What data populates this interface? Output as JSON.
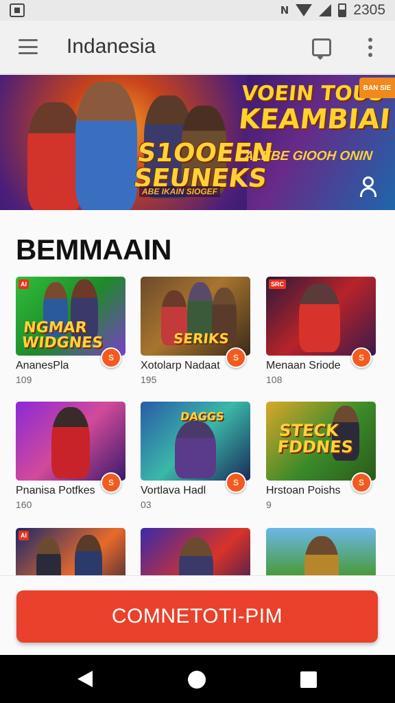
{
  "status_bar": {
    "signal_text": "N",
    "time": "2305"
  },
  "app_bar": {
    "title": "Indanesia"
  },
  "banner": {
    "logo_line1": "S1OOEEN",
    "logo_line2": "SEUNEKS",
    "logo_sub": "ABE IKAIN SIOGEF",
    "headline_line1": "VOEIN TOUS",
    "headline_line2": "KEAMBIAI",
    "tagline": "ALKBE GIOOH ONIN",
    "badge": "BAN SIE"
  },
  "section": {
    "title": "BEMMAAIN"
  },
  "games": [
    {
      "name": "AnanesPla",
      "count": "109",
      "thumb_text": "NGMAR WIDGNES",
      "tag": "AI"
    },
    {
      "name": "Xotolarp Nadaat",
      "count": "195",
      "thumb_text": "SERIKS",
      "tag": ""
    },
    {
      "name": "Menaan Sriode",
      "count": "108",
      "thumb_text": "",
      "tag": "SRC"
    },
    {
      "name": "Pnanisa Potfkes",
      "count": "160",
      "thumb_text": "",
      "tag": ""
    },
    {
      "name": "Vortlava Hadl",
      "count": "03",
      "thumb_text": "DAGGS",
      "tag": ""
    },
    {
      "name": "Hrstoan Poishs",
      "count": "9",
      "thumb_text": "STECK FDDNES",
      "tag": ""
    },
    {
      "name": "",
      "count": "",
      "thumb_text": "",
      "tag": "AI"
    },
    {
      "name": "",
      "count": "",
      "thumb_text": "",
      "tag": ""
    },
    {
      "name": "",
      "count": "",
      "thumb_text": "",
      "tag": ""
    }
  ],
  "play_badge_label": "S",
  "cta": {
    "label": "COMNETOTI-PIM"
  },
  "colors": {
    "accent": "#e9412c",
    "badge": "#f15a22",
    "logo_gold": "#ffd23a"
  },
  "icons": [
    "menu-icon",
    "cast-icon",
    "more-vert-icon",
    "user-icon",
    "back-icon",
    "home-icon",
    "recents-icon"
  ]
}
